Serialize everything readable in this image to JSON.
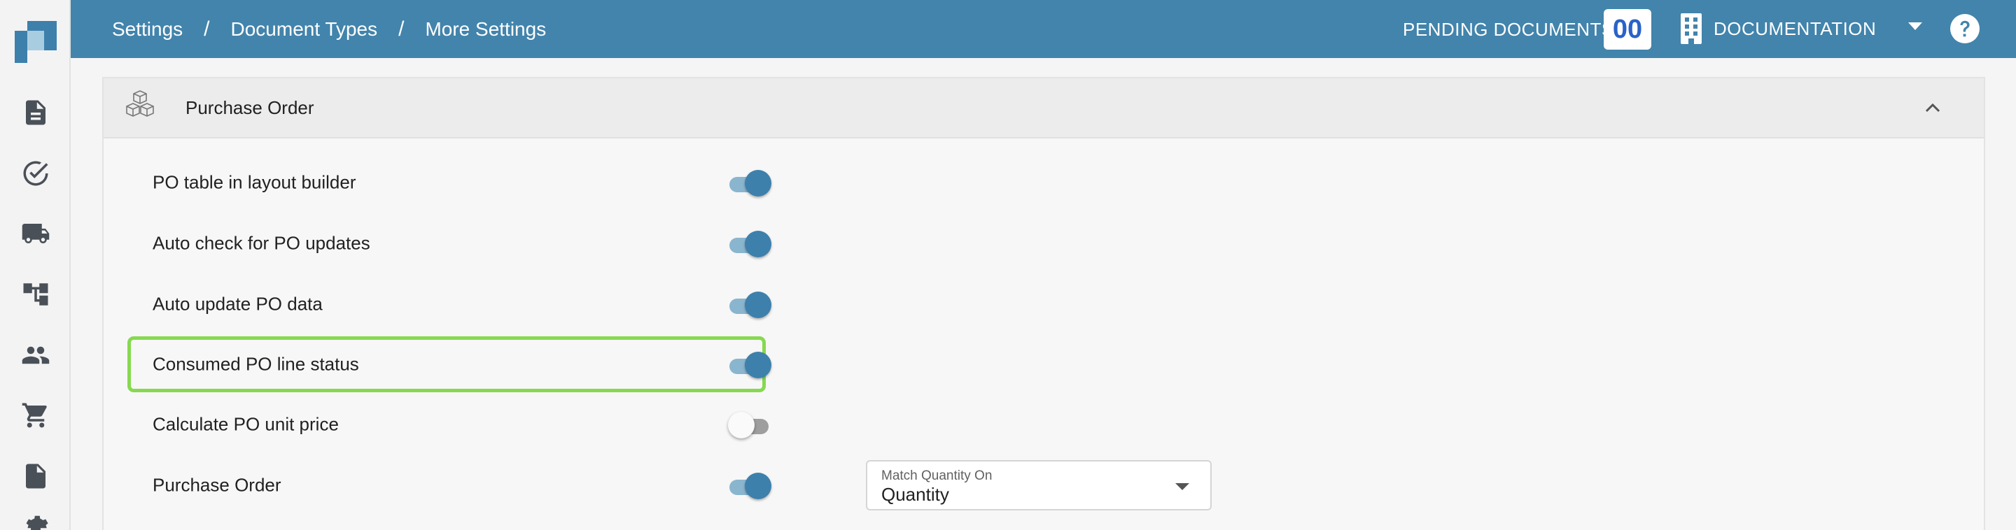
{
  "breadcrumb": [
    "Settings",
    "Document Types",
    "More Settings"
  ],
  "breadcrumb_separator": "/",
  "header": {
    "pending_label": "PENDING DOCUMENTS:",
    "pending_count": "00",
    "org_name": "DOCUMENTATION"
  },
  "sidebar": {
    "items": [
      {
        "icon": "document-icon"
      },
      {
        "icon": "check-circle-icon"
      },
      {
        "icon": "truck-icon"
      },
      {
        "icon": "hierarchy-icon"
      },
      {
        "icon": "people-icon"
      },
      {
        "icon": "cart-icon"
      },
      {
        "icon": "invoice-icon"
      },
      {
        "icon": "settings-icon"
      }
    ]
  },
  "panel": {
    "title": "Purchase Order",
    "icon": "cubes-icon",
    "expanded": true
  },
  "settings": [
    {
      "label": "PO table in layout builder",
      "enabled": true
    },
    {
      "label": "Auto check for PO updates",
      "enabled": true
    },
    {
      "label": "Auto update PO data",
      "enabled": true
    },
    {
      "label": "Consumed PO line status",
      "enabled": true,
      "highlighted": true
    },
    {
      "label": "Calculate PO unit price",
      "enabled": false
    },
    {
      "label": "Purchase Order",
      "enabled": true
    }
  ],
  "match_select": {
    "label": "Match Quantity On",
    "value": "Quantity"
  },
  "colors": {
    "topbar": "#4284ac",
    "toggle_on": "#3d80ac",
    "highlight": "#86d94f",
    "pending_count": "#2a62c8"
  }
}
